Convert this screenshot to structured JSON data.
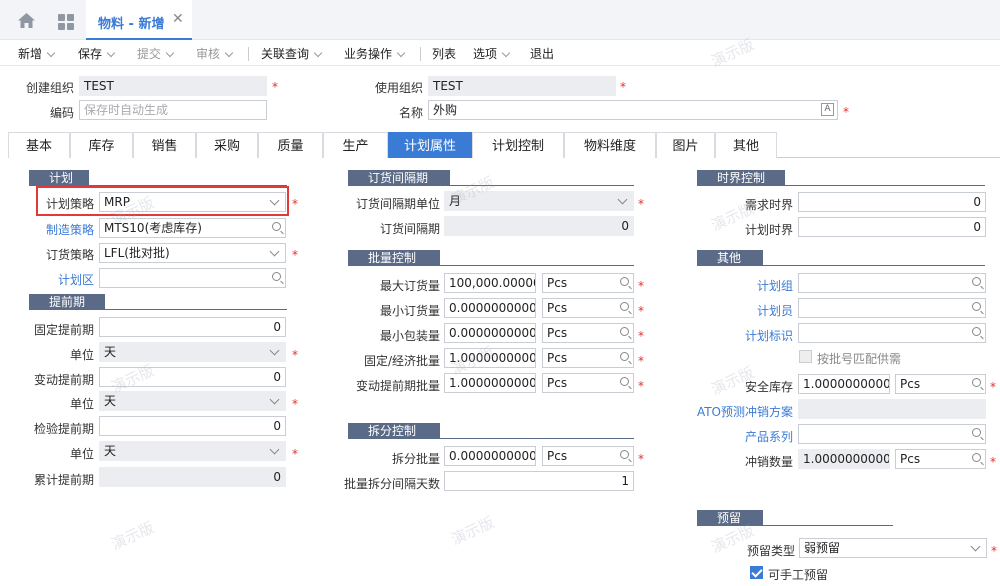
{
  "tab_title": "物料 - 新增",
  "toolbar": {
    "new": "新增",
    "save": "保存",
    "submit": "提交",
    "audit": "审核",
    "query": "关联查询",
    "ops": "业务操作",
    "list": "列表",
    "options": "选项",
    "exit": "退出"
  },
  "header": {
    "create_org_label": "创建组织",
    "create_org": "TEST",
    "use_org_label": "使用组织",
    "use_org": "TEST",
    "code_label": "编码",
    "code_placeholder": "保存时自动生成",
    "name_label": "名称",
    "name": "外购"
  },
  "tabs": [
    "基本",
    "库存",
    "销售",
    "采购",
    "质量",
    "生产",
    "计划属性",
    "计划控制",
    "物料维度",
    "图片",
    "其他"
  ],
  "plan": {
    "title": "计划",
    "strategy_label": "计划策略",
    "strategy": "MRP",
    "mfg_label": "制造策略",
    "mfg": "MTS10(考虑库存)",
    "order_label": "订货策略",
    "order": "LFL(批对批)",
    "zone_label": "计划区"
  },
  "lead": {
    "title": "提前期",
    "fixed_label": "固定提前期",
    "fixed": "0",
    "unit_label": "单位",
    "unit": "天",
    "var_label": "变动提前期",
    "var": "0",
    "insp_label": "检验提前期",
    "insp": "0",
    "cum_label": "累计提前期",
    "cum": "0"
  },
  "interval": {
    "title": "订货间隔期",
    "unit_label": "订货间隔期单位",
    "unit": "月",
    "value_label": "订货间隔期",
    "value": "0"
  },
  "batch": {
    "title": "批量控制",
    "max_label": "最大订货量",
    "max": "100,000.00000",
    "max_u": "Pcs",
    "min_label": "最小订货量",
    "min": "0.0000000000",
    "min_u": "Pcs",
    "pack_label": "最小包装量",
    "pack": "0.0000000000",
    "pack_u": "Pcs",
    "eco_label": "固定/经济批量",
    "eco": "1.0000000000",
    "eco_u": "Pcs",
    "varlead_label": "变动提前期批量",
    "varlead": "1.0000000000",
    "varlead_u": "Pcs"
  },
  "split": {
    "title": "拆分控制",
    "qty_label": "拆分批量",
    "qty": "0.0000000000",
    "qty_u": "Pcs",
    "days_label": "批量拆分间隔天数",
    "days": "1"
  },
  "fence": {
    "title": "时界控制",
    "demand_label": "需求时界",
    "demand": "0",
    "plan_label": "计划时界",
    "plan": "0"
  },
  "other": {
    "title": "其他",
    "group_label": "计划组",
    "planner_label": "计划员",
    "mark_label": "计划标识",
    "lot_label": "按批号匹配供需",
    "safety_label": "安全库存",
    "safety": "1.0000000000",
    "safety_u": "Pcs",
    "ato_label": "ATO预测冲销方案",
    "series_label": "产品系列",
    "offset_label": "冲销数量",
    "offset": "1.0000000000",
    "offset_u": "Pcs"
  },
  "reserve": {
    "title": "预留",
    "type_label": "预留类型",
    "type": "弱预留",
    "manual_label": "可手工预留"
  },
  "watermark": "演示版",
  "colors": {
    "accent": "#3a7bd5",
    "section": "#5b6a86",
    "required": "#e0322b"
  }
}
